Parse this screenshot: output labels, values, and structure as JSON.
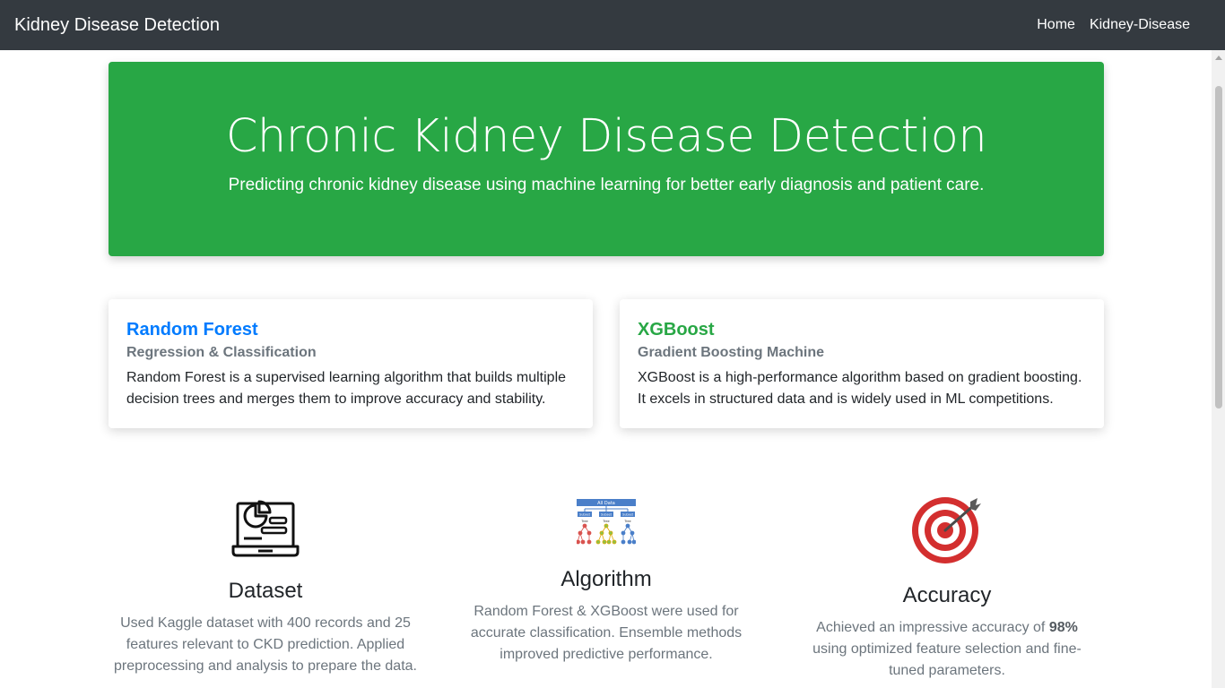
{
  "navbar": {
    "brand": "Kidney Disease Detection",
    "links": [
      "Home",
      "Kidney-Disease"
    ]
  },
  "hero": {
    "title": "Chronic Kidney Disease Detection",
    "subtitle": "Predicting chronic kidney disease using machine learning for better early diagnosis and patient care."
  },
  "cards": [
    {
      "title": "Random Forest",
      "subtitle": "Regression & Classification",
      "text": "Random Forest is a supervised learning algorithm that builds multiple decision trees and merges them to improve accuracy and stability."
    },
    {
      "title": "XGBoost",
      "subtitle": "Gradient Boosting Machine",
      "text": "XGBoost is a high-performance algorithm based on gradient boosting. It excels in structured data and is widely used in ML competitions."
    }
  ],
  "features": {
    "dataset": {
      "icon": "laptop-chart-icon",
      "title": "Dataset",
      "text": "Used Kaggle dataset with 400 records and 25 features relevant to CKD prediction. Applied preprocessing and analysis to prepare the data."
    },
    "algorithm": {
      "icon": "decision-tree-icon",
      "title": "Algorithm",
      "text": "Random Forest & XGBoost were used for accurate classification. Ensemble methods improved predictive performance."
    },
    "accuracy": {
      "icon": "target-icon",
      "title": "Accuracy",
      "text_before": "Achieved an impressive accuracy of ",
      "value": "98%",
      "text_after": " using optimized feature selection and fine-tuned parameters."
    }
  },
  "tree_labels": {
    "root": "All Data",
    "subsets": [
      "Subset",
      "Subset",
      "Subset"
    ],
    "trees": [
      "Tree",
      "Tree",
      "Tree"
    ]
  },
  "colors": {
    "navbar": "#343a40",
    "hero": "#28a745",
    "rf_title": "#007bff",
    "xgb_title": "#28a745",
    "muted": "#6c757d",
    "target_red": "#d32f2f"
  }
}
